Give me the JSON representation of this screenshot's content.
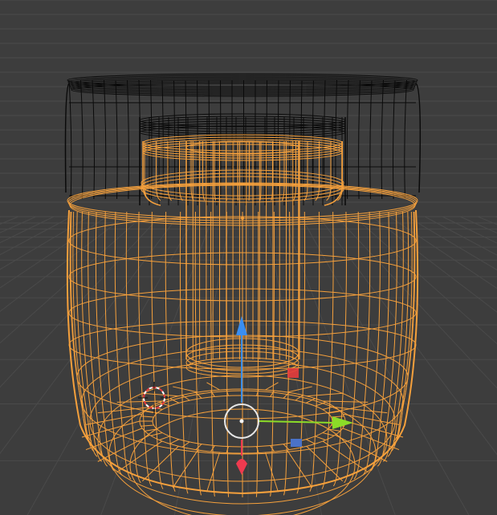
{
  "viewport": {
    "background": "#3d3d3d",
    "grid_color": "#4a4a4a",
    "selected_wire_color": "#f5a03c",
    "unselected_wire_color": "#0a0a0a"
  },
  "gizmo": {
    "x_axis_color": "#8bdc28",
    "y_axis_color": "#ef3a4f",
    "z_axis_color": "#3a8ef0",
    "x_plane_handle_color": "#e63c3c",
    "y_plane_handle_color": "#4a72c8",
    "center_ring_color": "#e8e8e8",
    "cursor_color": "#ffffff",
    "icons": [
      "move-gizmo-icon",
      "3d-cursor-icon"
    ]
  }
}
